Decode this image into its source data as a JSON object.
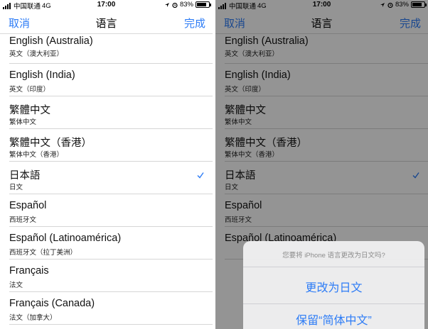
{
  "status_bar": {
    "carrier": "中国联通",
    "network": "4G",
    "time": "17:00",
    "battery": "83%",
    "battery_level": 0.83
  },
  "nav": {
    "cancel": "取消",
    "title": "语言",
    "done": "完成"
  },
  "languages_left": [
    {
      "title": "English (Australia)",
      "subtitle": "英文（澳大利亚）"
    },
    {
      "title": "English (India)",
      "subtitle": "英文（印度）"
    },
    {
      "title": "繁體中文",
      "subtitle": "繁体中文"
    },
    {
      "title": "繁體中文（香港）",
      "subtitle": "繁体中文（香港）"
    },
    {
      "title": "日本語",
      "subtitle": "日文"
    },
    {
      "title": "Español",
      "subtitle": "西班牙文"
    },
    {
      "title": "Español (Latinoamérica)",
      "subtitle": "西班牙文（拉丁美洲）"
    },
    {
      "title": "Français",
      "subtitle": "法文"
    },
    {
      "title": "Français (Canada)",
      "subtitle": "法文（加拿大）"
    }
  ],
  "languages_right": [
    {
      "title": "English (Australia)",
      "subtitle": "英文（澳大利亚）"
    },
    {
      "title": "English (India)",
      "subtitle": "英文（印度）"
    },
    {
      "title": "繁體中文",
      "subtitle": "繁体中文"
    },
    {
      "title": "繁體中文（香港）",
      "subtitle": "繁体中文（香港）"
    },
    {
      "title": "日本語",
      "subtitle": "日文"
    },
    {
      "title": "Español",
      "subtitle": "西班牙文"
    },
    {
      "title": "Español (Latinoamérica)",
      "subtitle": ""
    }
  ],
  "selected_language": "日本語",
  "action_sheet": {
    "message": "您要将 iPhone 语言更改为日文吗?",
    "confirm": "更改为日文",
    "keep": "保留“简体中文”"
  },
  "colors": {
    "accent": "#2d7cf6",
    "separator": "#d6d6d6",
    "overlay": "rgba(0,0,0,0.42)"
  },
  "icons": [
    "signal-icon",
    "location-icon",
    "alarm-icon",
    "lock-rotation-icon",
    "battery-icon",
    "checkmark-icon"
  ]
}
